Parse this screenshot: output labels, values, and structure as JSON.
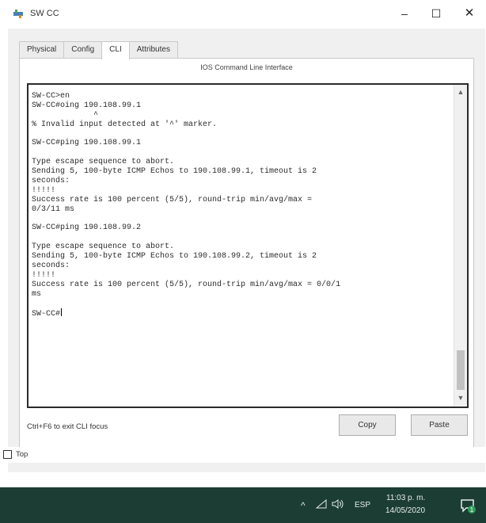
{
  "window": {
    "title": "SW CC",
    "minimize": "–",
    "maximize": "☐",
    "close": "✕",
    "icon": "cisco-switch-icon"
  },
  "tabs": [
    {
      "label": "Physical",
      "active": false
    },
    {
      "label": "Config",
      "active": false
    },
    {
      "label": "CLI",
      "active": true
    },
    {
      "label": "Attributes",
      "active": false
    }
  ],
  "panel": {
    "title": "IOS Command Line Interface"
  },
  "terminal": {
    "lines": [
      "SW-CC>en",
      "SW-CC#oing 190.108.99.1",
      "             ^",
      "% Invalid input detected at '^' marker.",
      "",
      "SW-CC#ping 190.108.99.1",
      "",
      "Type escape sequence to abort.",
      "Sending 5, 100-byte ICMP Echos to 190.108.99.1, timeout is 2",
      "seconds:",
      "!!!!!",
      "Success rate is 100 percent (5/5), round-trip min/avg/max =",
      "0/3/11 ms",
      "",
      "SW-CC#ping 190.108.99.2",
      "",
      "Type escape sequence to abort.",
      "Sending 5, 100-byte ICMP Echos to 190.108.99.2, timeout is 2",
      "seconds:",
      "!!!!!",
      "Success rate is 100 percent (5/5), round-trip min/avg/max = 0/0/1",
      "ms",
      "",
      "SW-CC#"
    ]
  },
  "footer": {
    "hint": "Ctrl+F6 to exit CLI focus",
    "copy_label": "Copy",
    "paste_label": "Paste"
  },
  "top_checkbox": {
    "label": "Top",
    "checked": false
  },
  "taskbar": {
    "language": "ESP",
    "time": "11:03 p. m.",
    "date": "14/05/2020",
    "background": "#1c3d33"
  }
}
